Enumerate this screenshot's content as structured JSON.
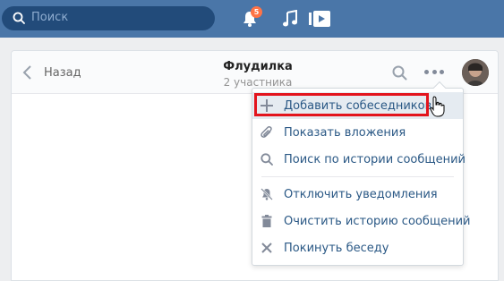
{
  "topbar": {
    "search_placeholder": "Поиск",
    "notifications_count": "5",
    "icons": [
      "search-icon",
      "bell-icon",
      "music-icon",
      "video-icon"
    ]
  },
  "header": {
    "back_label": "Назад",
    "title": "Флудилка",
    "subtitle": "2 участника"
  },
  "menu": {
    "items": [
      {
        "label": "Добавить собеседников",
        "icon": "plus-icon"
      },
      {
        "label": "Показать вложения",
        "icon": "paperclip-icon"
      },
      {
        "label": "Поиск по истории сообщений",
        "icon": "search-icon"
      },
      {
        "label": "Отключить уведомления",
        "icon": "mute-icon"
      },
      {
        "label": "Очистить историю сообщений",
        "icon": "trash-icon"
      },
      {
        "label": "Покинуть беседу",
        "icon": "close-icon"
      }
    ]
  },
  "colors": {
    "topbar": "#4a76a8",
    "link": "#2a5885",
    "highlight_box": "#e3141d",
    "badge": "#ff7346"
  }
}
